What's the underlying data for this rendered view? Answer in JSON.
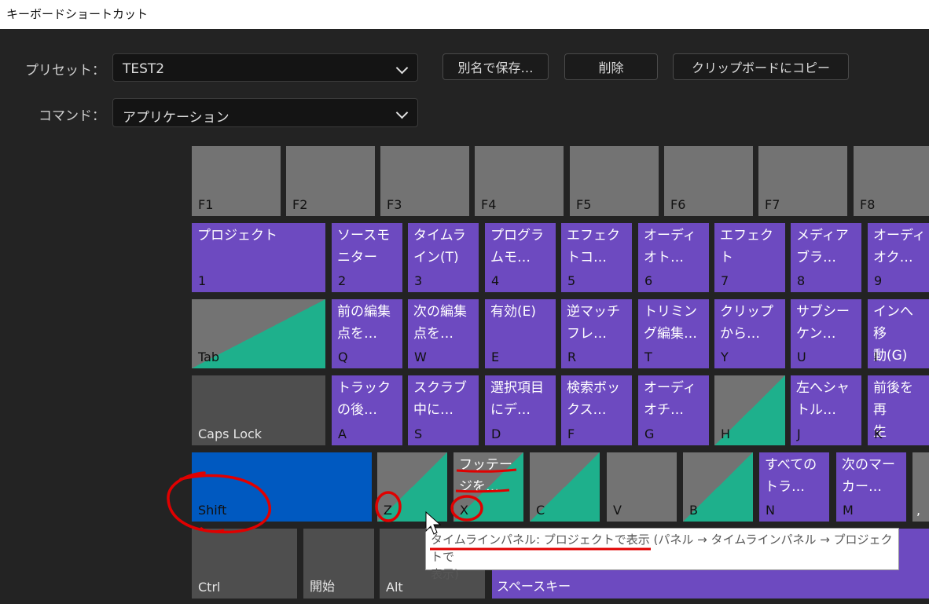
{
  "window": {
    "title": "キーボードショートカット"
  },
  "preset": {
    "label": "プリセット：",
    "value": "TEST2"
  },
  "command": {
    "label": "コマンド：",
    "value": "アプリケーション"
  },
  "buttons": {
    "save_as": "別名で保存…",
    "delete": "削除",
    "copy_clipboard": "クリップボードにコピー"
  },
  "keys": {
    "F1": {
      "code": "F1"
    },
    "F2": {
      "code": "F2"
    },
    "F3": {
      "code": "F3"
    },
    "F4": {
      "code": "F4"
    },
    "F5": {
      "code": "F5"
    },
    "F6": {
      "code": "F6"
    },
    "F7": {
      "code": "F7"
    },
    "F8": {
      "code": "F8"
    },
    "k1": {
      "code": "1",
      "name": "プロジェクト"
    },
    "k2": {
      "code": "2",
      "name": "ソースモ\nニター"
    },
    "k3": {
      "code": "3",
      "name": "タイムラ\nイン(T)"
    },
    "k4": {
      "code": "4",
      "name": "プログラ\nムモ…"
    },
    "k5": {
      "code": "5",
      "name": "エフェク\nトコ…"
    },
    "k6": {
      "code": "6",
      "name": "オーディ\nオト…"
    },
    "k7": {
      "code": "7",
      "name": "エフェク\nト"
    },
    "k8": {
      "code": "8",
      "name": "メディア\nブラ…"
    },
    "k9": {
      "code": "9",
      "name": "オーディ\nオク…"
    },
    "Tab": {
      "code": "Tab"
    },
    "Q": {
      "code": "Q",
      "name": "前の編集\n点を…"
    },
    "W": {
      "code": "W",
      "name": "次の編集\n点を…"
    },
    "E": {
      "code": "E",
      "name": "有効(E)"
    },
    "R": {
      "code": "R",
      "name": "逆マッチ\nフレ…"
    },
    "T": {
      "code": "T",
      "name": "トリミン\nグ編集…"
    },
    "Y": {
      "code": "Y",
      "name": "クリップ\nから…"
    },
    "U": {
      "code": "U",
      "name": "サブシー\nケン…"
    },
    "I": {
      "code": "I",
      "name": "インへ移\n動(G)"
    },
    "CapsLock": {
      "code": "Caps Lock"
    },
    "A": {
      "code": "A",
      "name": "トラック\nの後…"
    },
    "S": {
      "code": "S",
      "name": "スクラブ\n中に…"
    },
    "D": {
      "code": "D",
      "name": "選択項目\nにデ…"
    },
    "F": {
      "code": "F",
      "name": "検索ボッ\nクス…"
    },
    "G": {
      "code": "G",
      "name": "オーディ\nオチ…"
    },
    "H": {
      "code": "H"
    },
    "J": {
      "code": "J",
      "name": "左へシャ\nトル…"
    },
    "K": {
      "code": "K",
      "name": "前後を再\n生"
    },
    "Shift": {
      "code": "Shift"
    },
    "Z": {
      "code": "Z"
    },
    "X": {
      "code": "X",
      "name": "フッテー\nジを…"
    },
    "C": {
      "code": "C"
    },
    "V": {
      "code": "V"
    },
    "B": {
      "code": "B"
    },
    "N": {
      "code": "N",
      "name": "すべての\nトラ…"
    },
    "M": {
      "code": "M",
      "name": "次のマー\nカー…"
    },
    "comma": {
      "code": ","
    },
    "Ctrl": {
      "code": "Ctrl"
    },
    "Start": {
      "code": "開始"
    },
    "Alt": {
      "code": "Alt"
    },
    "Space": {
      "code": "スペースキー"
    }
  },
  "tooltip": {
    "line1": "タイムラインパネル: プロジェクトで表示 (パネル → タイムラインパネル → プロジェクトで",
    "line2": "表示)"
  },
  "colors": {
    "assigned": "#6d4ac0",
    "partial": "#1eb08c",
    "unassigned": "#737373",
    "modifier_active": "#0059c0",
    "annotation": "#e00000"
  }
}
